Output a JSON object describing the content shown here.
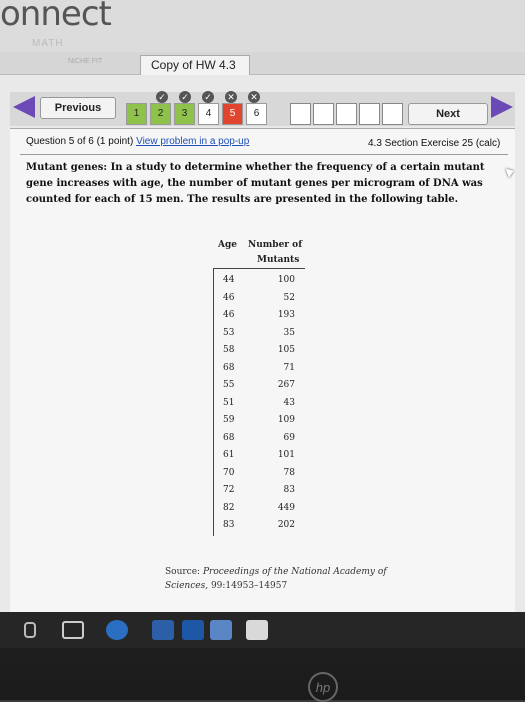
{
  "brand": {
    "logo": "onnect",
    "sub": "MATH"
  },
  "tabs": {
    "left_label": "NICHE FIT",
    "active_label": "Copy of HW 4.3"
  },
  "nav": {
    "previous_label": "Previous",
    "next_label": "Next",
    "questions": [
      {
        "number": "1",
        "state": "correct"
      },
      {
        "number": "2",
        "state": "correct"
      },
      {
        "number": "3",
        "state": "correct"
      },
      {
        "number": "4",
        "state": "current"
      },
      {
        "number": "5",
        "state": "incorrect"
      },
      {
        "number": "6",
        "state": "unanswered"
      }
    ]
  },
  "question": {
    "header": "Question 5 of 6 (1 point)",
    "popup_link": "View problem in a pop-up",
    "section": "4.3 Section Exercise 25 (calc)",
    "text": "Mutant genes: In a study to determine whether the frequency of a certain mutant gene increases with age, the number of mutant genes per microgram of DNA was counted for each of 15 men. The results are presented in the following table."
  },
  "table": {
    "col_age": "Age",
    "col_mutants_1": "Number of",
    "col_mutants_2": "Mutants",
    "rows": [
      {
        "age": "44",
        "mutants": "100"
      },
      {
        "age": "46",
        "mutants": "52"
      },
      {
        "age": "46",
        "mutants": "193"
      },
      {
        "age": "53",
        "mutants": "35"
      },
      {
        "age": "58",
        "mutants": "105"
      },
      {
        "age": "68",
        "mutants": "71"
      },
      {
        "age": "55",
        "mutants": "267"
      },
      {
        "age": "51",
        "mutants": "43"
      },
      {
        "age": "59",
        "mutants": "109"
      },
      {
        "age": "68",
        "mutants": "69"
      },
      {
        "age": "61",
        "mutants": "101"
      },
      {
        "age": "70",
        "mutants": "78"
      },
      {
        "age": "72",
        "mutants": "83"
      },
      {
        "age": "82",
        "mutants": "449"
      },
      {
        "age": "83",
        "mutants": "202"
      }
    ]
  },
  "source": {
    "prefix": "Source:",
    "title": "Proceedings of the National Academy of Sciences,",
    "pages": "99:14953–14957"
  },
  "device": {
    "logo": "hp"
  }
}
